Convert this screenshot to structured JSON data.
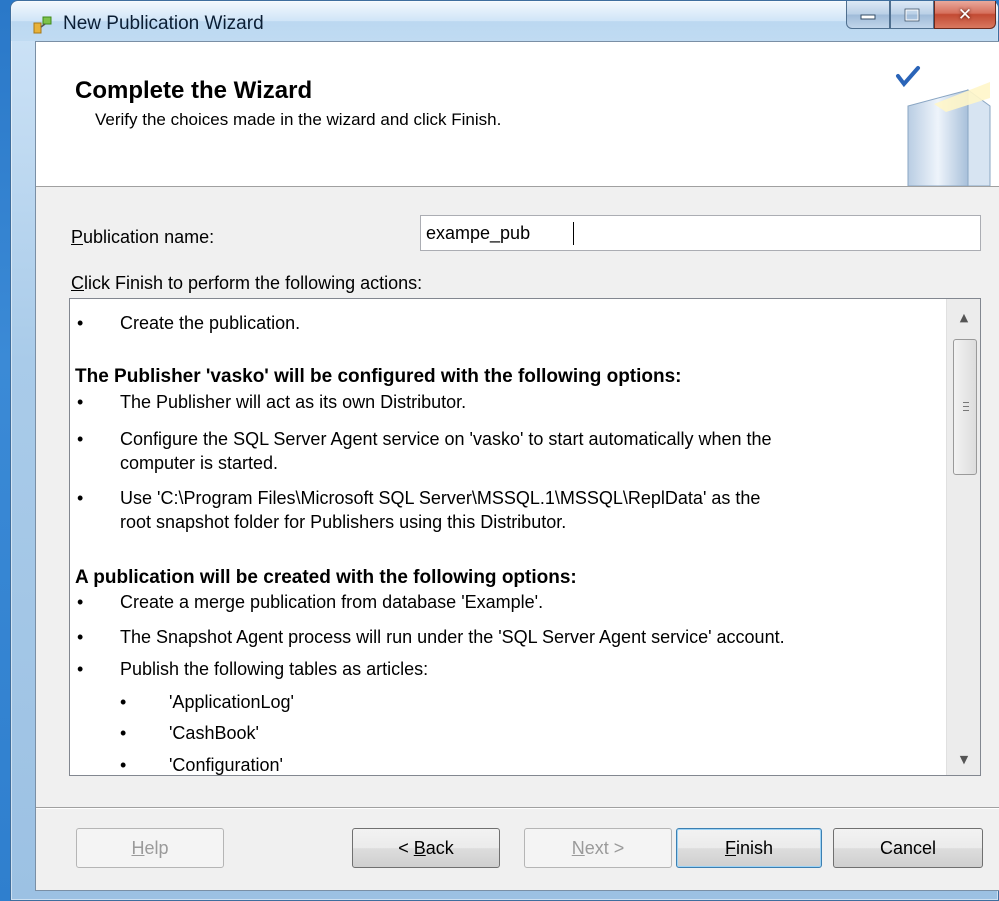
{
  "window": {
    "title": "New Publication Wizard"
  },
  "header": {
    "title": "Complete the Wizard",
    "subtitle": "Verify the choices made in the wizard and click Finish."
  },
  "form": {
    "publication_label_first": "P",
    "publication_label_rest": "ublication name:",
    "publication_value": "exampe_pub",
    "actions_label_first": "C",
    "actions_label_rest": "lick Finish to perform the following actions:"
  },
  "actions": {
    "intro_item": "Create the publication.",
    "publisher_heading": "The Publisher 'vasko' will be configured with the following options:",
    "publisher_items": [
      "The Publisher will act as its own Distributor.",
      "Configure the SQL Server Agent service on 'vasko' to start automatically when the",
      "computer is started.",
      "Use 'C:\\Program Files\\Microsoft SQL Server\\MSSQL.1\\MSSQL\\ReplData' as the",
      "root snapshot folder for Publishers using this Distributor."
    ],
    "publication_heading": "A publication will be created with the following options:",
    "publication_items": [
      "Create a merge publication from database 'Example'.",
      "The Snapshot Agent process will run under the 'SQL Server Agent service' account.",
      "Publish the following tables as articles:"
    ],
    "articles": [
      "'ApplicationLog'",
      "'CashBook'",
      "'Configuration'"
    ],
    "bullet": "•"
  },
  "buttons": {
    "help_first": "H",
    "help_rest": "elp",
    "back_prefix": "< ",
    "back_first": "B",
    "back_rest": "ack",
    "next_first": "N",
    "next_rest": "ext >",
    "finish_first": "F",
    "finish_rest": "inish",
    "cancel": "Cancel"
  }
}
